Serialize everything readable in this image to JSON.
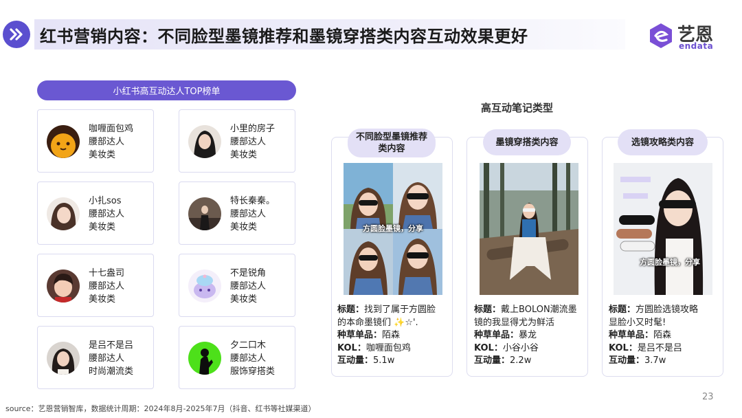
{
  "header": {
    "title": "红书营销内容：不同脸型墨镜推荐和墨镜穿搭类内容互动效果更好",
    "logo_text": "艺恩",
    "logo_sub": "endata"
  },
  "ranking": {
    "title": "小红书高互动达人TOP榜单",
    "kols": [
      {
        "name": "咖喱面包鸡",
        "level": "腰部达人",
        "category": "美妆类"
      },
      {
        "name": "小里的房子",
        "level": "腰部达人",
        "category": "美妆类"
      },
      {
        "name": "小扎sos",
        "level": "腰部达人",
        "category": "美妆类"
      },
      {
        "name": "特长秦秦。",
        "level": "腰部达人",
        "category": "美妆类"
      },
      {
        "name": "十七盎司",
        "level": "腰部达人",
        "category": "美妆类"
      },
      {
        "name": "不是锐角",
        "level": "腰部达人",
        "category": "美妆类"
      },
      {
        "name": "是吕不是吕",
        "level": "腰部达人",
        "category": "时尚潮流类"
      },
      {
        "name": "夕二口木",
        "level": "腰部达人",
        "category": "服饰穿搭类"
      }
    ]
  },
  "notes": {
    "title": "高互动笔记类型",
    "types": [
      {
        "label": "不同脸型墨镜推荐类内容",
        "photo_caption": "方圆脸墨镜，分享",
        "title_label": "标题：",
        "title_line1": "找到了属于方圆脸",
        "title_line2": "的本命墨镜们 ✨☆'.",
        "product_label": "种草单品：",
        "product": "陌森",
        "kol_label": "KOL：",
        "kol": "咖喱面包鸡",
        "engagement_label": "互动量：",
        "engagement": "5.1w"
      },
      {
        "label": "墨镜穿搭类内容",
        "photo_caption": "",
        "title_label": "标题：",
        "title_line1": "戴上BOLON潮流墨",
        "title_line2": "镜的我显得尤为鲜活",
        "product_label": "种草单品：",
        "product": "暴龙",
        "kol_label": "KOL：",
        "kol": "小谷小谷",
        "engagement_label": "互动量：",
        "engagement": "2.2w"
      },
      {
        "label": "选镜攻略类内容",
        "photo_caption": "方圆脸墨镜，分享",
        "title_label": "标题：",
        "title_line1": "方圆脸选镜攻略",
        "title_line2": "显脸小又时髦!",
        "product_label": "种草单品：",
        "product": "陌森",
        "kol_label": "KOL：",
        "kol": "是吕不是吕",
        "engagement_label": "互动量：",
        "engagement": "3.7w"
      }
    ]
  },
  "footer": {
    "source": "source：艺恩营销智库，数据统计周期：2024年8月-2025年7月（抖音、红书等社媒渠道）",
    "page_number": "23"
  },
  "colors": {
    "accent": "#6a58d2",
    "pill_light": "#e3e0f6",
    "card_border": "#dadaf0"
  }
}
